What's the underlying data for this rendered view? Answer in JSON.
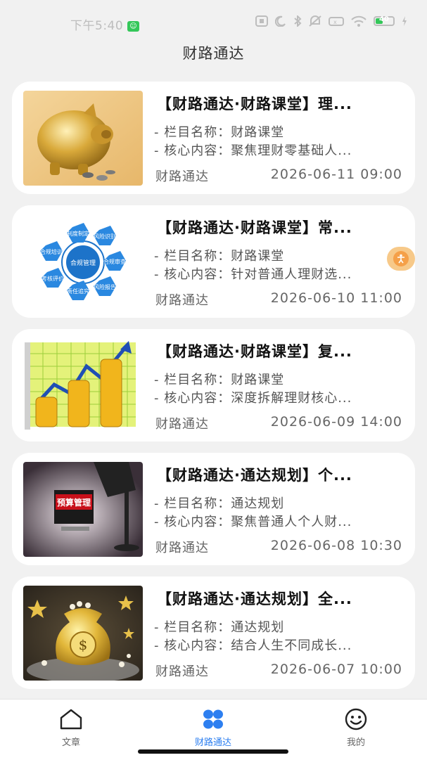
{
  "status_bar": {
    "time": "下午5:40",
    "sim_badge": "☺",
    "battery_level": "40",
    "icons": [
      "nfc-icon",
      "moon-icon",
      "bluetooth-icon",
      "mute-icon",
      "signal-icon",
      "wifi-icon",
      "battery-icon",
      "charging-icon"
    ]
  },
  "header": {
    "title": "财路通达"
  },
  "articles": [
    {
      "title": "【财路通达·财路课堂】理...",
      "line1": "- 栏目名称：财路课堂",
      "line2": "- 核心内容：聚焦理财零基础人...",
      "source": "财路通达",
      "date": "2026-06-11 09:00",
      "thumb": "gold-piggy-bank"
    },
    {
      "title": "【财路通达·财路课堂】常...",
      "line1": "- 栏目名称：财路课堂",
      "line2": "- 核心内容：针对普通人理财选...",
      "source": "财路通达",
      "date": "2026-06-10 11:00",
      "thumb": "compliance-diagram",
      "thumb_labels": [
        "合规管理",
        "制度制定",
        "风险识别",
        "合规审查",
        "风险报告",
        "责任追究",
        "考核评价",
        "合规培训"
      ]
    },
    {
      "title": "【财路通达·财路课堂】复...",
      "line1": "- 栏目名称：财路课堂",
      "line2": "- 核心内容：深度拆解理财核心...",
      "source": "财路通达",
      "date": "2026-06-09 14:00",
      "thumb": "coin-growth-chart"
    },
    {
      "title": "【财路通达·通达规划】个...",
      "line1": "- 栏目名称：通达规划",
      "line2": "- 核心内容：聚焦普通人个人财...",
      "source": "财路通达",
      "date": "2026-06-08 10:30",
      "thumb": "budget-management",
      "thumb_sign": "预算管理"
    },
    {
      "title": "【财路通达·通达规划】全...",
      "line1": "- 栏目名称：通达规划",
      "line2": "- 核心内容：结合人生不同成长...",
      "source": "财路通达",
      "date": "2026-06-07 10:00",
      "thumb": "gold-money-bag"
    }
  ],
  "float_button": {
    "icon": "accessibility-icon"
  },
  "tabs": [
    {
      "label": "文章",
      "icon": "home-icon",
      "active": false
    },
    {
      "label": "财路通达",
      "icon": "grid-icon",
      "active": true
    },
    {
      "label": "我的",
      "icon": "smile-icon",
      "active": false
    }
  ],
  "colors": {
    "accent": "#2d7ff0",
    "background": "#f1f1f1",
    "card": "#ffffff"
  }
}
